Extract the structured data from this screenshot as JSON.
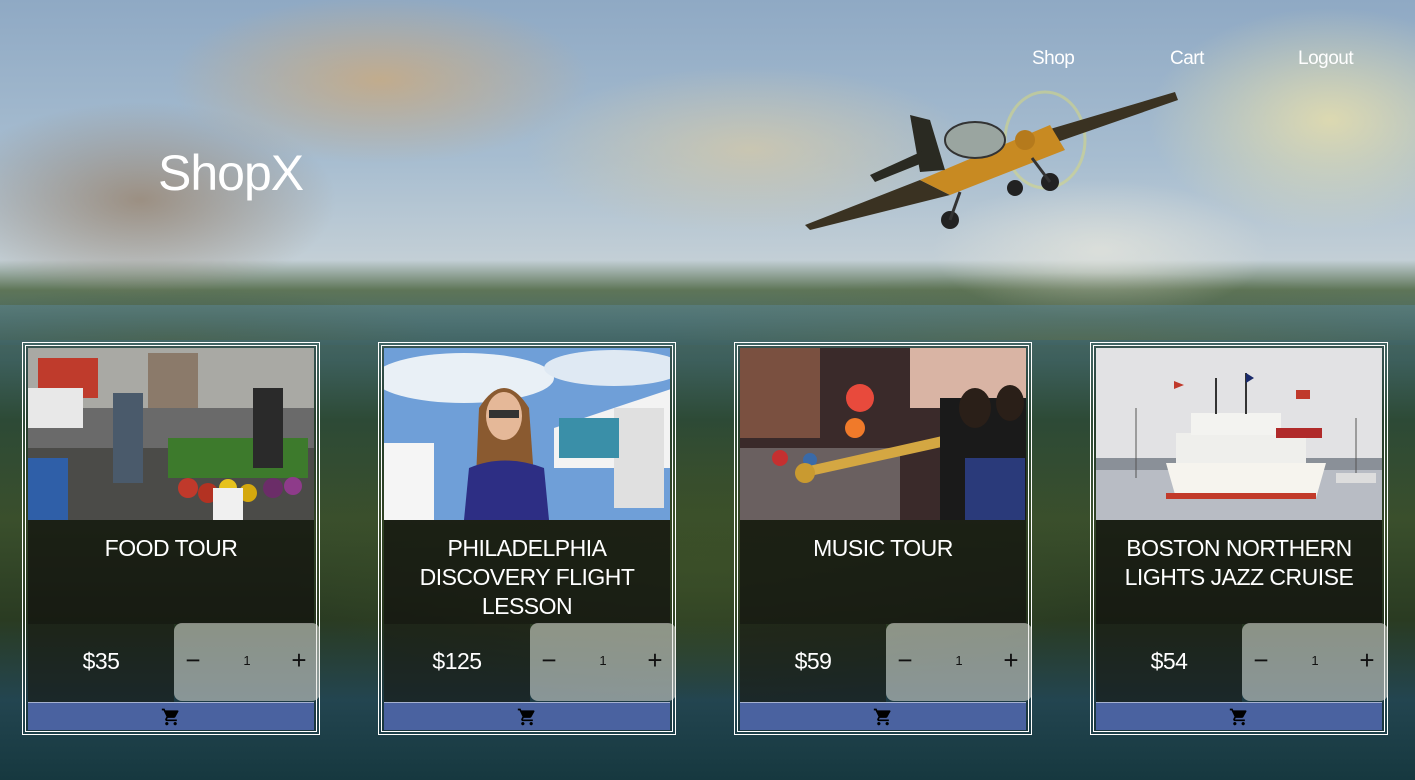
{
  "header": {
    "logo": "ShopX",
    "nav": [
      {
        "label": "Shop"
      },
      {
        "label": "Cart"
      },
      {
        "label": "Logout"
      }
    ]
  },
  "products": [
    {
      "title": "FOOD TOUR",
      "price": "$35",
      "quantity": "1"
    },
    {
      "title": "PHILADELPHIA DISCOVERY FLIGHT LESSON",
      "price": "$125",
      "quantity": "1"
    },
    {
      "title": "MUSIC TOUR",
      "price": "$59",
      "quantity": "1"
    },
    {
      "title": "BOSTON NORTHERN LIGHTS JAZZ CRUISE",
      "price": "$54",
      "quantity": "1"
    }
  ],
  "stepper": {
    "minus_icon": "minus-icon",
    "plus_icon": "plus-icon"
  },
  "colors": {
    "cart_button": "#4a62a0",
    "text": "#ffffff"
  }
}
